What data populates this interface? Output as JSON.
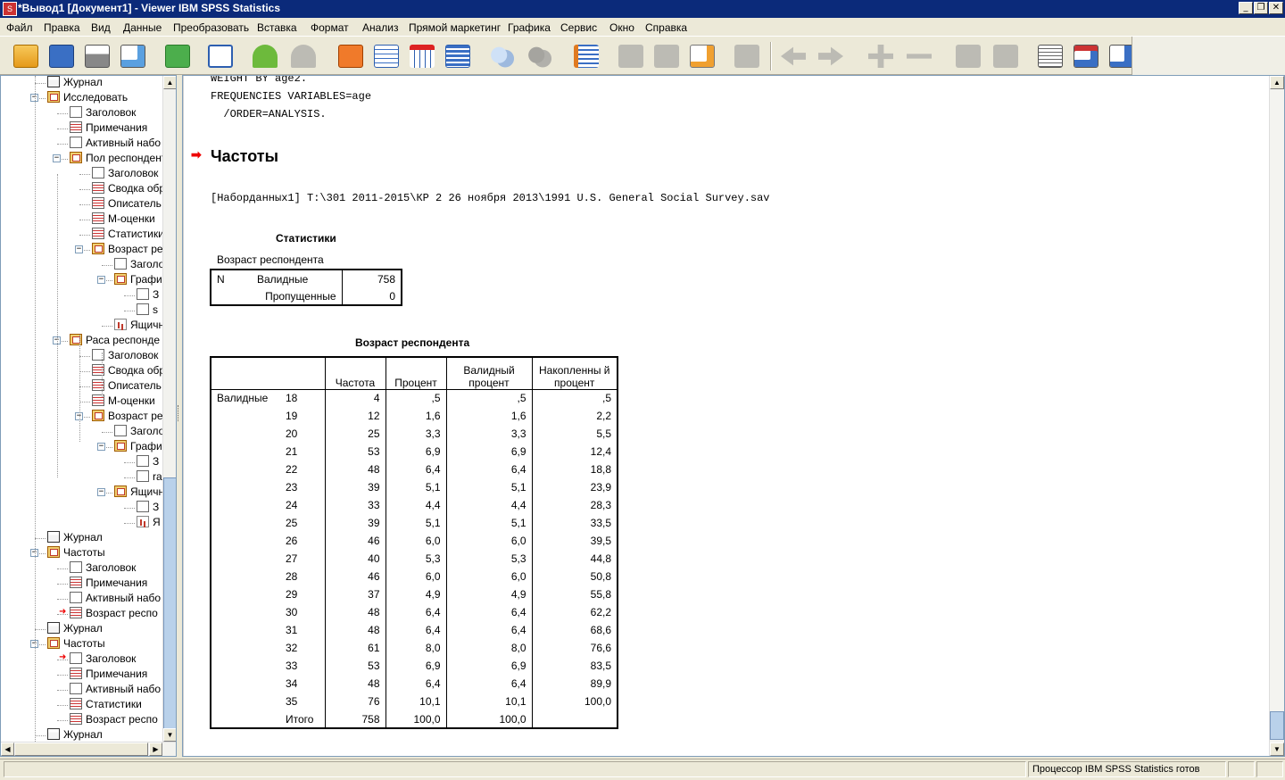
{
  "window": {
    "title": "*Вывод1 [Документ1] - Viewer IBM SPSS Statistics",
    "min": "_",
    "restore": "❐",
    "close": "✕"
  },
  "menu": [
    "Файл",
    "Правка",
    "Вид",
    "Данные",
    "Преобразовать",
    "Вставка",
    "Формат",
    "Анализ",
    "Прямой маркетинг",
    "Графика",
    "Сервис",
    "Окно",
    "Справка"
  ],
  "outline": {
    "nodes": [
      {
        "label": "Журнал",
        "icon": "book"
      },
      {
        "label": "Исследовать",
        "icon": "folder"
      },
      {
        "label": "Заголовок",
        "icon": "doc"
      },
      {
        "label": "Примечания",
        "icon": "table"
      },
      {
        "label": "Активный набо",
        "icon": "doc"
      },
      {
        "label": "Пол респондент",
        "icon": "folder"
      },
      {
        "label": "Заголовок",
        "icon": "doc"
      },
      {
        "label": "Сводка обр",
        "icon": "table"
      },
      {
        "label": "Описатель",
        "icon": "table"
      },
      {
        "label": "М-оценки",
        "icon": "table"
      },
      {
        "label": "Статистики",
        "icon": "table"
      },
      {
        "label": "Возраст ре",
        "icon": "folder"
      },
      {
        "label": "Заголо",
        "icon": "doc"
      },
      {
        "label": "Графи",
        "icon": "folder"
      },
      {
        "label": "З",
        "icon": "doc"
      },
      {
        "label": "s",
        "icon": "doc"
      },
      {
        "label": "Ящичн",
        "icon": "chart"
      },
      {
        "label": "Раса респонде",
        "icon": "folder"
      },
      {
        "label": "Заголовок",
        "icon": "doc"
      },
      {
        "label": "Сводка обр",
        "icon": "table"
      },
      {
        "label": "Описатель",
        "icon": "table"
      },
      {
        "label": "М-оценки",
        "icon": "table"
      },
      {
        "label": "Возраст ре",
        "icon": "folder"
      },
      {
        "label": "Заголо",
        "icon": "doc"
      },
      {
        "label": "Графи",
        "icon": "folder"
      },
      {
        "label": "З",
        "icon": "doc"
      },
      {
        "label": "ra",
        "icon": "doc"
      },
      {
        "label": "Ящичн",
        "icon": "folder"
      },
      {
        "label": "З",
        "icon": "doc"
      },
      {
        "label": "Я",
        "icon": "chart"
      },
      {
        "label": "Журнал",
        "icon": "book"
      },
      {
        "label": "Частоты",
        "icon": "folder"
      },
      {
        "label": "Заголовок",
        "icon": "doc"
      },
      {
        "label": "Примечания",
        "icon": "table"
      },
      {
        "label": "Активный набо",
        "icon": "doc"
      },
      {
        "label": "Возраст респо",
        "icon": "table"
      },
      {
        "label": "Журнал",
        "icon": "book"
      },
      {
        "label": "Частоты",
        "icon": "folder"
      },
      {
        "label": "Заголовок",
        "icon": "doc"
      },
      {
        "label": "Примечания",
        "icon": "table"
      },
      {
        "label": "Активный набо",
        "icon": "doc"
      },
      {
        "label": "Статистики",
        "icon": "table"
      },
      {
        "label": "Возраст респо",
        "icon": "table"
      },
      {
        "label": "Журнал",
        "icon": "book"
      }
    ]
  },
  "syntax": {
    "line1": "WEIGHT BY age2.",
    "line2": "FREQUENCIES VARIABLES=age",
    "line3": "  /ORDER=ANALYSIS."
  },
  "heading": "Частоты",
  "dataset_line": "[Наборданных1] T:\\301 2011-2015\\КР 2 26 ноября 2013\\1991 U.S. General Social Survey.sav",
  "stats_table": {
    "title": "Статистики",
    "subtitle": "Возраст респондента",
    "n_label": "N",
    "valid_label": "Валидные",
    "valid_value": "758",
    "missing_label": "Пропущенные",
    "missing_value": "0"
  },
  "freq_table": {
    "title": "Возраст респондента",
    "col_freq": "Частота",
    "col_pct": "Процент",
    "col_valid_pct": "Валидный процент",
    "col_cum_pct": "Накопленны й процент",
    "group_label": "Валидные",
    "rows": [
      {
        "age": "18",
        "freq": "4",
        "pct": ",5",
        "vpct": ",5",
        "cum": ",5"
      },
      {
        "age": "19",
        "freq": "12",
        "pct": "1,6",
        "vpct": "1,6",
        "cum": "2,2"
      },
      {
        "age": "20",
        "freq": "25",
        "pct": "3,3",
        "vpct": "3,3",
        "cum": "5,5"
      },
      {
        "age": "21",
        "freq": "53",
        "pct": "6,9",
        "vpct": "6,9",
        "cum": "12,4"
      },
      {
        "age": "22",
        "freq": "48",
        "pct": "6,4",
        "vpct": "6,4",
        "cum": "18,8"
      },
      {
        "age": "23",
        "freq": "39",
        "pct": "5,1",
        "vpct": "5,1",
        "cum": "23,9"
      },
      {
        "age": "24",
        "freq": "33",
        "pct": "4,4",
        "vpct": "4,4",
        "cum": "28,3"
      },
      {
        "age": "25",
        "freq": "39",
        "pct": "5,1",
        "vpct": "5,1",
        "cum": "33,5"
      },
      {
        "age": "26",
        "freq": "46",
        "pct": "6,0",
        "vpct": "6,0",
        "cum": "39,5"
      },
      {
        "age": "27",
        "freq": "40",
        "pct": "5,3",
        "vpct": "5,3",
        "cum": "44,8"
      },
      {
        "age": "28",
        "freq": "46",
        "pct": "6,0",
        "vpct": "6,0",
        "cum": "50,8"
      },
      {
        "age": "29",
        "freq": "37",
        "pct": "4,9",
        "vpct": "4,9",
        "cum": "55,8"
      },
      {
        "age": "30",
        "freq": "48",
        "pct": "6,4",
        "vpct": "6,4",
        "cum": "62,2"
      },
      {
        "age": "31",
        "freq": "48",
        "pct": "6,4",
        "vpct": "6,4",
        "cum": "68,6"
      },
      {
        "age": "32",
        "freq": "61",
        "pct": "8,0",
        "vpct": "8,0",
        "cum": "76,6"
      },
      {
        "age": "33",
        "freq": "53",
        "pct": "6,9",
        "vpct": "6,9",
        "cum": "83,5"
      },
      {
        "age": "34",
        "freq": "48",
        "pct": "6,4",
        "vpct": "6,4",
        "cum": "89,9"
      },
      {
        "age": "35",
        "freq": "76",
        "pct": "10,1",
        "vpct": "10,1",
        "cum": "100,0"
      }
    ],
    "total_label": "Итого",
    "total_freq": "758",
    "total_pct": "100,0",
    "total_vpct": "100,0"
  },
  "status": {
    "processor": "Процессор IBM SPSS Statistics  готов"
  }
}
